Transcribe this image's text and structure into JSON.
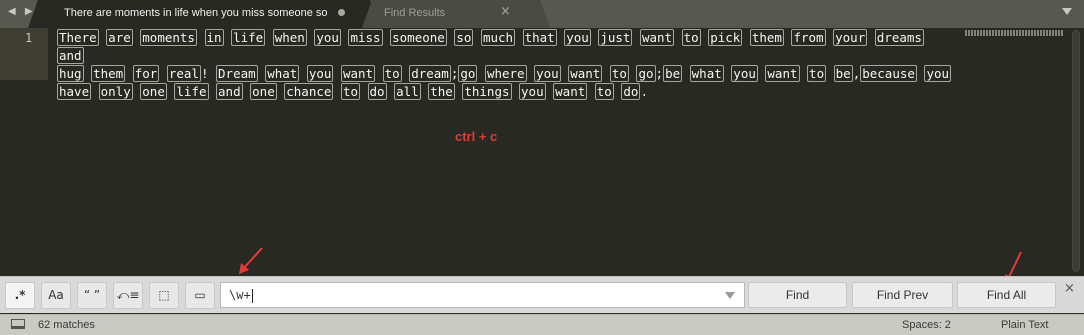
{
  "tabs": [
    {
      "title": "There are moments in life when you miss someone so",
      "active": true,
      "modified": true
    },
    {
      "title": "Find Results",
      "active": false,
      "close_glyph": "×"
    }
  ],
  "editor": {
    "line_number": "1",
    "lines": [
      "There are moments in life when you miss someone so much that you just want to pick them from your dreams and",
      "hug them for real! Dream what you want to dream;go where you want to go;be what you want to be,because you",
      "have only one life and one chance to do all the things you want to do."
    ]
  },
  "annotation": "ctrl + c",
  "find": {
    "options": [
      {
        "glyph": ".*",
        "name": "regex-toggle",
        "on": true
      },
      {
        "glyph": "Aa",
        "name": "case-sensitive-toggle",
        "on": false
      },
      {
        "glyph": "“ ”",
        "name": "whole-word-toggle",
        "on": false
      },
      {
        "glyph": "⤺≡",
        "name": "wrap-toggle",
        "on": false
      },
      {
        "glyph": "⬚",
        "name": "in-selection-toggle",
        "on": false
      },
      {
        "glyph": "▭",
        "name": "highlight-matches-toggle",
        "on": false
      }
    ],
    "query": "\\w+",
    "buttons": {
      "find": "Find",
      "find_prev": "Find Prev",
      "find_all": "Find All"
    },
    "close": "×"
  },
  "status": {
    "matches": "62 matches",
    "spaces": "Spaces: 2",
    "syntax": "Plain Text"
  },
  "colors": {
    "editor_bg": "#282923",
    "annotation": "#e53935",
    "panel_bg": "#d9d9d9"
  }
}
